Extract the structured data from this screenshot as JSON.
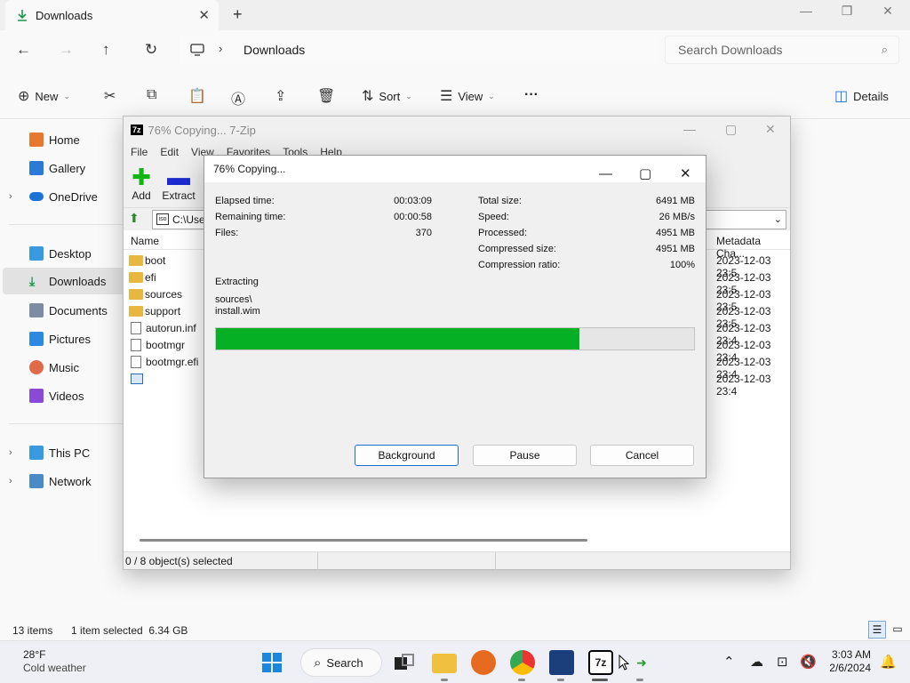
{
  "explorer": {
    "tab_title": "Downloads",
    "address_crumb": "Downloads",
    "search_placeholder": "Search Downloads",
    "commands": {
      "new": "New",
      "sort": "Sort",
      "view": "View",
      "details": "Details"
    },
    "nav": {
      "home": "Home",
      "gallery": "Gallery",
      "onedrive": "OneDrive",
      "desktop": "Desktop",
      "downloads": "Downloads",
      "documents": "Documents",
      "pictures": "Pictures",
      "music": "Music",
      "videos": "Videos",
      "thispc": "This PC",
      "network": "Network"
    },
    "status": {
      "items": "13 items",
      "selected": "1 item selected  6.34 GB"
    }
  },
  "zip": {
    "title": "76% Copying... 7-Zip",
    "menu": [
      "File",
      "Edit",
      "View",
      "Favorites",
      "Tools",
      "Help"
    ],
    "toolbar": {
      "add": "Add",
      "extract": "Extract"
    },
    "path": "C:\\Use",
    "columns": {
      "name": "Name",
      "metadata": "Metadata Cha..."
    },
    "files": [
      {
        "name": "boot",
        "kind": "folder",
        "date": "2023-12-03 23:5"
      },
      {
        "name": "efi",
        "kind": "folder",
        "date": "2023-12-03 23:5"
      },
      {
        "name": "sources",
        "kind": "folder",
        "date": "2023-12-03 23:5"
      },
      {
        "name": "support",
        "kind": "folder",
        "date": "2023-12-03 23:5"
      },
      {
        "name": "autorun.inf",
        "kind": "file",
        "date": "2023-12-03 23:4"
      },
      {
        "name": "bootmgr",
        "kind": "file",
        "date": "2023-12-03 23:4"
      },
      {
        "name": "bootmgr.efi",
        "kind": "file",
        "date": "2023-12-03 23:4"
      },
      {
        "name": "",
        "kind": "image",
        "date": "2023-12-03 23:4"
      }
    ],
    "status": "0 / 8 object(s) selected"
  },
  "dialog": {
    "title": "76% Copying...",
    "elapsed_label": "Elapsed time:",
    "elapsed": "00:03:09",
    "remaining_label": "Remaining time:",
    "remaining": "00:00:58",
    "files_label": "Files:",
    "files": "370",
    "total_label": "Total size:",
    "total": "6491 MB",
    "speed_label": "Speed:",
    "speed": "26 MB/s",
    "processed_label": "Processed:",
    "processed": "4951 MB",
    "compressed_label": "Compressed size:",
    "compressed": "4951 MB",
    "ratio_label": "Compression ratio:",
    "ratio": "100%",
    "action": "Extracting",
    "folder": "sources\\",
    "file": "install.wim",
    "progress_percent": 76,
    "buttons": {
      "background": "Background",
      "pause": "Pause",
      "cancel": "Cancel"
    }
  },
  "taskbar": {
    "temp": "28°F",
    "weather": "Cold weather",
    "search": "Search",
    "time": "3:03 AM",
    "date": "2/6/2024"
  },
  "colors": {
    "progress": "#06b025",
    "accent": "#1a6fd0"
  }
}
